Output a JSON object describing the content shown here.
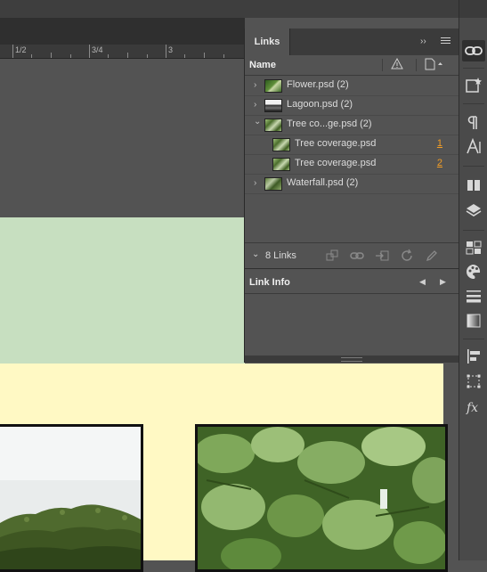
{
  "panel": {
    "tab_label": "Links",
    "collapse_glyph": "››",
    "column_name": "Name",
    "links": [
      {
        "name": "Flower.psd (2)",
        "expanded": false,
        "child": false,
        "page": "",
        "thumb": "flower"
      },
      {
        "name": "Lagoon.psd (2)",
        "expanded": false,
        "child": false,
        "page": "",
        "thumb": "lagoon"
      },
      {
        "name": "Tree co...ge.psd (2)",
        "expanded": true,
        "child": false,
        "page": "",
        "thumb": "tree"
      },
      {
        "name": "Tree coverage.psd",
        "expanded": false,
        "child": true,
        "page": "1",
        "thumb": "tree"
      },
      {
        "name": "Tree coverage.psd",
        "expanded": false,
        "child": true,
        "page": "2",
        "thumb": "tree"
      },
      {
        "name": "Waterfall.psd (2)",
        "expanded": false,
        "child": false,
        "page": "",
        "thumb": "waterfall"
      }
    ],
    "footer_count": "8 Links",
    "link_info_label": "Link Info"
  },
  "ruler": {
    "labels": [
      "1/2",
      "3/4",
      "3"
    ]
  },
  "colors": {
    "page_green": "#c7dfc0",
    "page_yellow": "#fff9c4",
    "page_number_link": "#f29d25",
    "panel_bg": "#535353"
  },
  "toolbar": {
    "icons": [
      "links-icon",
      "cc-libraries-icon",
      "paragraph-icon",
      "character-icon",
      "pages-icon",
      "layers-icon",
      "swatches-icon",
      "color-icon",
      "stroke-icon",
      "gradient-icon",
      "align-icon",
      "transform-icon",
      "effects-icon"
    ]
  }
}
